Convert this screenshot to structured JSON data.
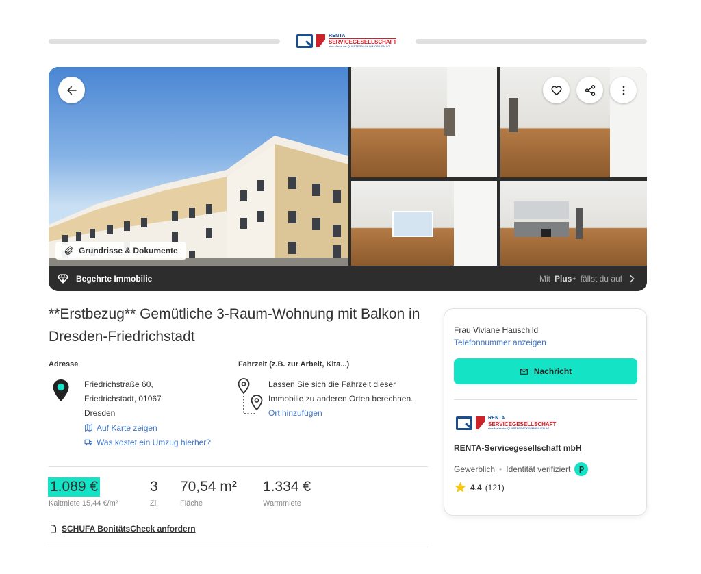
{
  "header": {
    "logo": {
      "line1": "RENTA",
      "line2": "SERVICEGESELLSCHAFT",
      "line3": "eine Marke der QUARTERBACK IMMOBILIEN AG."
    }
  },
  "gallery": {
    "floorplans_label": "Grundrisse & Dokumente",
    "badge_label": "Begehrte Immobilie",
    "plus_prefix": "Mit",
    "plus_brand": "Plus",
    "plus_suffix": "fällst du auf",
    "icons": [
      "arrow-left-icon",
      "heart-icon",
      "share-icon",
      "more-vertical-icon",
      "paperclip-icon",
      "diamond-icon",
      "chevron-right-icon"
    ]
  },
  "listing": {
    "title": "**Erstbezug** Gemütliche 3-Raum-Wohnung mit Balkon in Dresden-Friedrichstadt",
    "address_label": "Adresse",
    "address_line1": "Friedrichstraße 60,",
    "address_line2": "Friedrichstadt, 01067",
    "address_line3": "Dresden",
    "map_link": "Auf Karte zeigen",
    "move_link": "Was kostet ein Umzug hierher?",
    "commute_label": "Fahrzeit (z.B. zur Arbeit, Kita...)",
    "commute_line1": "Lassen Sie sich die Fahrzeit dieser",
    "commute_line2": "Immobilie zu anderen Orten berechnen.",
    "commute_link": "Ort hinzufügen",
    "price": "1.089 €",
    "price_sub": "Kaltmiete 15,44 €/m²",
    "rooms": "3",
    "rooms_sub": "Zi.",
    "area": "70,54 m²",
    "area_sub": "Fläche",
    "warm": "1.334 €",
    "warm_sub": "Warmmiete",
    "schufa_link": "SCHUFA BonitätsCheck anfordern",
    "highlight_color": "#14e3c5"
  },
  "contact": {
    "name": "Frau Viviane Hauschild",
    "phone_link": "Telefonnummer anzeigen",
    "message_button": "Nachricht",
    "company": "RENTA-Servicegesellschaft mbH",
    "type": "Gewerblich",
    "verified": "Identität verifiziert",
    "rating": "4.4",
    "reviews": "(121)",
    "accent": "#14e3c5"
  }
}
